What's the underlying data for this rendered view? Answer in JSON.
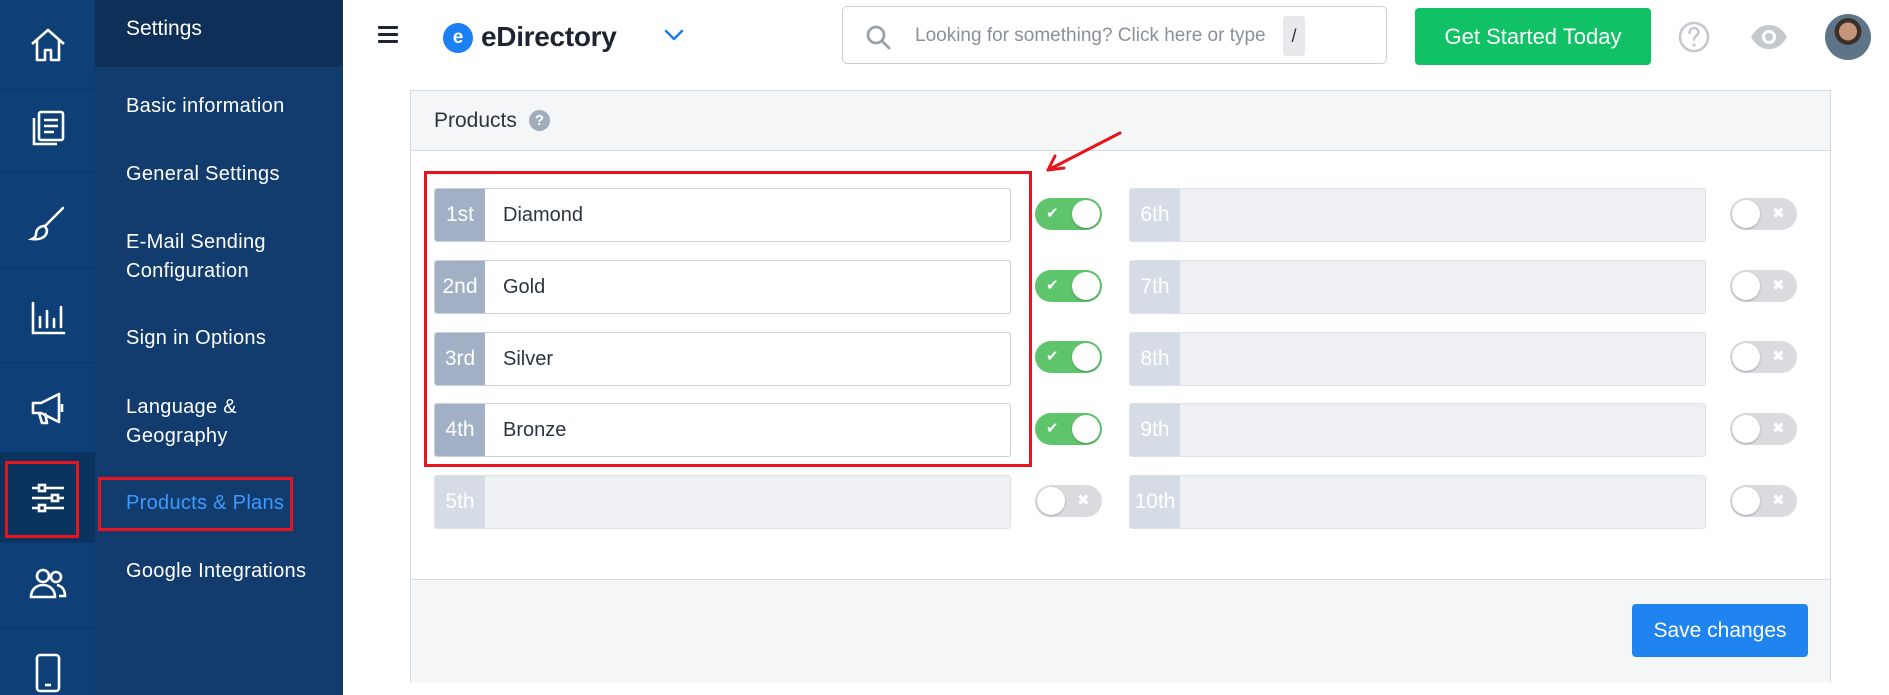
{
  "sidebar": {
    "title": "Settings",
    "items": [
      {
        "label": "Basic information"
      },
      {
        "label": "General Settings"
      },
      {
        "label": "E-Mail Sending Configuration"
      },
      {
        "label": "Sign in Options"
      },
      {
        "label": "Language & Geography"
      },
      {
        "label": "Products & Plans",
        "active": true
      },
      {
        "label": "Google Integrations"
      }
    ]
  },
  "rail": {
    "icons": [
      "home-icon",
      "pages-icon",
      "brush-icon",
      "bar-chart-icon",
      "megaphone-icon",
      "sliders-icon",
      "users-icon",
      "mobile-icon"
    ],
    "active": "sliders-icon"
  },
  "header": {
    "logo_letter": "e",
    "brand": "eDirectory",
    "search": {
      "placeholder": "Looking for something? Click here or type",
      "shortcut": "/"
    },
    "cta_label": "Get Started Today",
    "icons": [
      "help-icon",
      "eye-icon",
      "avatar"
    ]
  },
  "products": {
    "title": "Products",
    "info_glyph": "?",
    "rows": [
      {
        "rank": "1st",
        "value": "Diamond",
        "enabled": true
      },
      {
        "rank": "2nd",
        "value": "Gold",
        "enabled": true
      },
      {
        "rank": "3rd",
        "value": "Silver",
        "enabled": true
      },
      {
        "rank": "4th",
        "value": "Bronze",
        "enabled": true
      },
      {
        "rank": "5th",
        "value": "",
        "enabled": false
      },
      {
        "rank": "6th",
        "value": "",
        "enabled": false
      },
      {
        "rank": "7th",
        "value": "",
        "enabled": false
      },
      {
        "rank": "8th",
        "value": "",
        "enabled": false
      },
      {
        "rank": "9th",
        "value": "",
        "enabled": false
      },
      {
        "rank": "10th",
        "value": "",
        "enabled": false
      }
    ],
    "save_label": "Save changes",
    "toggle_on_glyph": "✔",
    "toggle_off_glyph": "✖"
  },
  "colors": {
    "rail_bg": "#0f3f77",
    "submenu_bg": "#123c6e",
    "active_link": "#3d9bff",
    "cta": "#10c265",
    "save": "#1f84f0",
    "toggle_on": "#5fc56c",
    "annotation": "#e8141c"
  }
}
